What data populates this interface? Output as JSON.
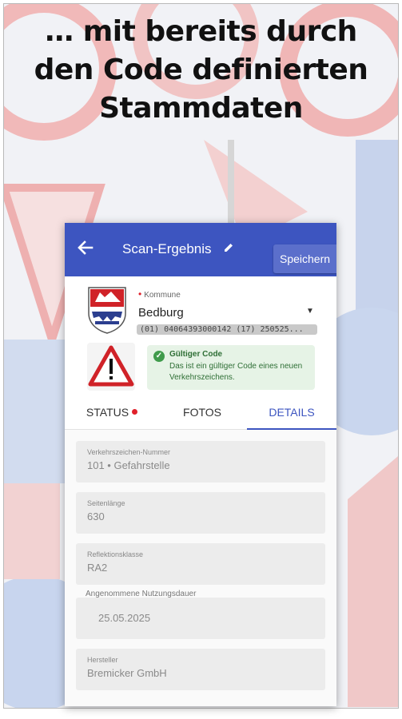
{
  "headline": {
    "line1": "… mit bereits durch",
    "line2": "den Code definierten",
    "line3": "Stammdaten"
  },
  "appbar": {
    "title": "Scan-Ergebnis",
    "save_label": "Speichern",
    "color": "#3d55c0"
  },
  "kommune": {
    "label": "Kommune",
    "value": "Bedburg",
    "code": "(01) 04064393000142 (17) 250525..."
  },
  "validation": {
    "title": "Gültiger Code",
    "text": "Das ist ein gültiger Code eines neuen Verkehrszeichens.",
    "color": "#3f9b4b"
  },
  "tabs": [
    {
      "label": "STATUS"
    },
    {
      "label": "FOTOS"
    },
    {
      "label": "DETAILS"
    }
  ],
  "fields": [
    {
      "label": "Verkehrszeichen-Nummer",
      "value": "101 • Gefahrstelle"
    },
    {
      "label": "Seitenlänge",
      "value": "630"
    },
    {
      "label": "Reflektionsklasse",
      "value": "RA2"
    },
    {
      "label": "Angenommene Nutzungsdauer",
      "value": "25.05.2025"
    },
    {
      "label": "Hersteller",
      "value": "Bremicker GmbH"
    }
  ],
  "icons": {
    "back": "arrow-left-icon",
    "edit": "edit-icon",
    "dropdown": "chevron-down-icon",
    "check": "check-circle-icon",
    "sign": "warning-sign-icon",
    "crest": "crest-icon"
  }
}
